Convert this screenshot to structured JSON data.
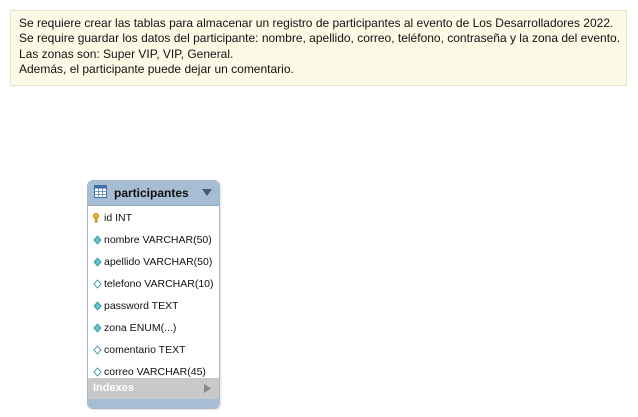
{
  "note": {
    "lines": [
      "Se requiere crear las tablas para almacenar un registro de participantes al evento de  Los Desarrolladores 2022.",
      "Se require guardar los datos del participante: nombre, apellido, correo, teléfono, contraseña y la zona del evento.",
      "Las zonas son: Super VIP, VIP, General.",
      "Además, el participante puede dejar un comentario."
    ],
    "background_color": "#fdfbe6"
  },
  "table": {
    "name": "participantes",
    "header_color": "#a6bdd4",
    "icon": "table-icon",
    "toggle_icon": "collapse-triangle-icon",
    "columns": [
      {
        "text": "id INT",
        "icon": "primary-key-icon"
      },
      {
        "text": "nombre VARCHAR(50)",
        "icon": "column-diamond-filled-icon"
      },
      {
        "text": "apellido VARCHAR(50)",
        "icon": "column-diamond-filled-icon"
      },
      {
        "text": "telefono VARCHAR(10)",
        "icon": "column-diamond-outline-icon"
      },
      {
        "text": "password TEXT",
        "icon": "column-diamond-filled-icon"
      },
      {
        "text": "zona ENUM(...)",
        "icon": "column-diamond-filled-icon"
      },
      {
        "text": "comentario TEXT",
        "icon": "column-diamond-outline-icon"
      },
      {
        "text": "correo VARCHAR(45)",
        "icon": "column-diamond-outline-icon"
      }
    ],
    "indexes_label": "Indexes",
    "indexes_icon": "expand-arrow-icon"
  }
}
